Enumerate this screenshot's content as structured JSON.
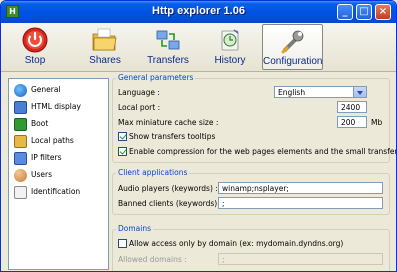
{
  "window": {
    "title": "Http explorer 1.06",
    "app_icon_letter": "H",
    "min": "_",
    "max": "□",
    "close": "×"
  },
  "toolbar": {
    "buttons": [
      {
        "label": "Stop",
        "icon": "stop-icon"
      },
      {
        "label": "Shares",
        "icon": "folder-icon"
      },
      {
        "label": "Transfers",
        "icon": "transfers-icon"
      },
      {
        "label": "History",
        "icon": "history-icon"
      },
      {
        "label": "Configuration",
        "icon": "wrench-icon",
        "selected": true
      }
    ]
  },
  "sidebar": {
    "items": [
      {
        "label": "General",
        "icon": "globe-icon",
        "selected": true
      },
      {
        "label": "HTML display",
        "icon": "monitor-icon"
      },
      {
        "label": "Boot",
        "icon": "boot-icon"
      },
      {
        "label": "Local paths",
        "icon": "folder-tree-icon"
      },
      {
        "label": "IP filters",
        "icon": "filter-icon"
      },
      {
        "label": "Users",
        "icon": "users-icon"
      },
      {
        "label": "Identification",
        "icon": "id-icon"
      }
    ]
  },
  "general": {
    "title": "General parameters",
    "language_label": "Language :",
    "language_value": "English",
    "local_port_label": "Local port :",
    "local_port_value": "2400",
    "cache_label": "Max miniature cache size :",
    "cache_value": "200",
    "cache_unit": "Mb",
    "tooltips_label": "Show transfers tooltips",
    "tooltips_checked": true,
    "compression_label": "Enable compression for the web pages elements and the small transfers",
    "compression_checked": true
  },
  "client": {
    "title": "Client applications",
    "audio_label": "Audio players (keywords) :",
    "audio_value": "winamp;nsplayer;",
    "banned_label": "Banned clients (keywords) :",
    "banned_value": ";"
  },
  "domains": {
    "title": "Domains",
    "allow_label": "Allow access only by domain (ex: mydomain.dyndns.org)",
    "allow_checked": false,
    "allowed_label": "Allowed domains :",
    "allowed_value": ";"
  },
  "colors": {
    "title_blue": "#0054e3",
    "group_title": "#0046d5",
    "face": "#ece9d8"
  }
}
